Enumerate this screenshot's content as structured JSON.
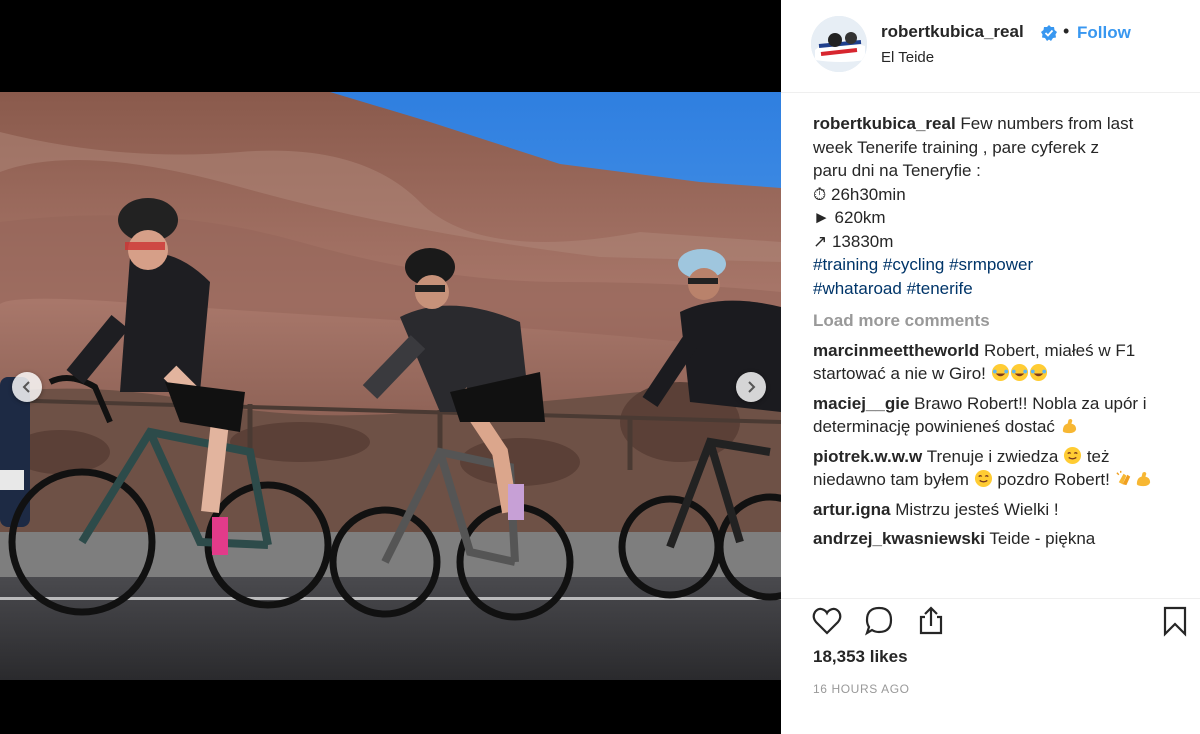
{
  "post": {
    "username": "robertkubica_real",
    "follow_label": "Follow",
    "location": "El Teide",
    "caption": {
      "username": "robertkubica_real",
      "lines": [
        "Few numbers from last",
        "week Tenerife training , pare cyferek z",
        "paru dni na Teneryfie :"
      ],
      "stats": {
        "time": "⏱ 26h30min",
        "distance": "► 620km",
        "elevation": "↗ 13830m"
      },
      "hashtags_line1": "#training #cycling #srmpower",
      "hashtags_line2": "#whataroad #tenerife"
    },
    "load_more": "Load more comments",
    "comments": [
      {
        "user": "marcinmeettheworld",
        "text": "Robert, miałeś w F1 startować a nie w Giro!"
      },
      {
        "user": "maciej__gie",
        "text": "Brawo Robert!! Nobla za upór i determinację powinieneś dostać"
      },
      {
        "user": "piotrek.w.w.w",
        "text_a": "Trenuje i zwiedza",
        "text_b": "też niedawno tam byłem",
        "text_c": "pozdro Robert!"
      },
      {
        "user": "artur.igna",
        "text": "Mistrzu jesteś Wielki !"
      },
      {
        "user": "andrzej_kwasniewski",
        "text": "Teide - piękna"
      }
    ],
    "likes": "18,353 likes",
    "time": "16 HOURS AGO"
  },
  "icons": {
    "verified": "verified-badge-icon",
    "like": "heart-icon",
    "comment": "comment-icon",
    "share": "share-icon",
    "save": "bookmark-icon",
    "prev": "chevron-left-icon",
    "next": "chevron-right-icon"
  },
  "colors": {
    "link": "#3897f0",
    "hashtag": "#003569",
    "muted": "#999999",
    "text": "#262626"
  }
}
